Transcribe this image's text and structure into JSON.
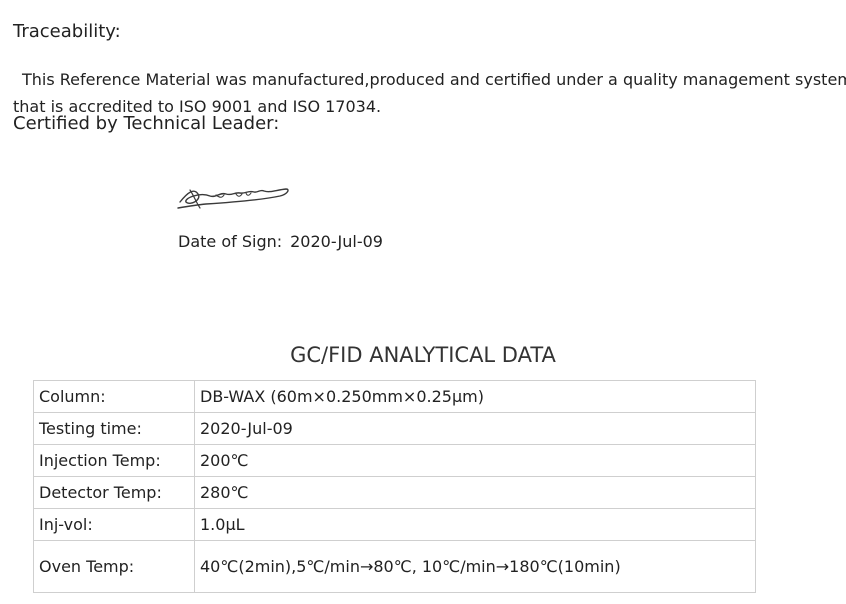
{
  "traceability": {
    "heading": "Traceability:",
    "line1": "This Reference Material was manufactured,produced and certified under a quality management system",
    "line2": "that is accredited to ISO 9001 and ISO 17034."
  },
  "certification": {
    "heading": "Certified by Technical Leader:",
    "signature_icon": "handwritten-signature",
    "date_label": "Date of Sign:",
    "date_value": "2020-Jul-09"
  },
  "analytical": {
    "title": "GC/FID ANALYTICAL DATA",
    "rows": [
      {
        "label": "Column:",
        "value": "DB-WAX (60m×0.250mm×0.25μm)"
      },
      {
        "label": "Testing time:",
        "value": "2020-Jul-09"
      },
      {
        "label": "Injection Temp:",
        "value": "200℃"
      },
      {
        "label": "Detector Temp:",
        "value": "280℃"
      },
      {
        "label": "Inj-vol:",
        "value": "1.0μL"
      },
      {
        "label": "Oven Temp:",
        "value": "40℃(2min),5℃/min→80℃, 10℃/min→180℃(10min)"
      }
    ]
  },
  "colors": {
    "text": "#222222",
    "table_border": "#cfcfcf"
  }
}
